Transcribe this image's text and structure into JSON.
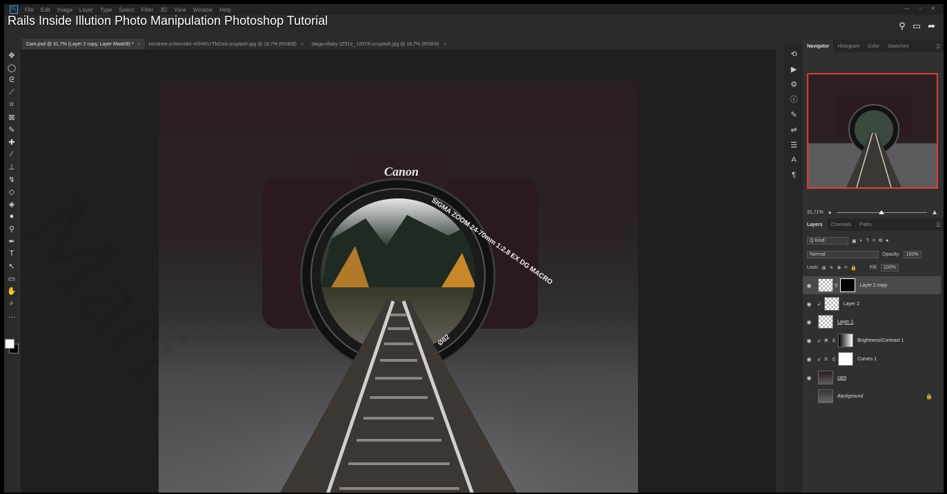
{
  "video_title": "Rails Inside Illution Photo Manipulation Photoshop Tutorial",
  "menu": [
    "File",
    "Edit",
    "Image",
    "Layer",
    "Type",
    "Select",
    "Filter",
    "3D",
    "View",
    "Window",
    "Help"
  ],
  "tabs": [
    {
      "label": "Cam.psd @ 31,7% (Layer 2 copy, Layer Mask/8) *",
      "close": "×"
    },
    {
      "label": "kendrew-schexnider-m5HKU-TbGaA-unsplash.jpg @ 16,7% (RGB/8)",
      "close": "×"
    },
    {
      "label": "daiga-ellaby-JZ51o_-UOY8-unsplash.jpg @ 16,7% (RGB/8)",
      "close": "×"
    }
  ],
  "tools": [
    "move-icon",
    "lasso-ellipse-icon",
    "lasso-icon",
    "quick-select-icon",
    "crop-icon",
    "frame-icon",
    "eyedropper-icon",
    "healing-icon",
    "brush-icon",
    "stamp-icon",
    "history-brush-icon",
    "eraser-icon",
    "paint-bucket-icon",
    "blur-icon",
    "dodge-icon",
    "pen-icon",
    "type-icon",
    "path-select-icon",
    "rectangle-icon",
    "hand-icon",
    "zoom-icon",
    "more-icon"
  ],
  "canvas": {
    "camera_brand": "Canon",
    "lens_text": "SIGMA ZOOM 24-70mm 1:2.8 EX DG MACRO",
    "lens_ring": "Ø82"
  },
  "panel": {
    "top_tabs": [
      "Navigator",
      "Histogram",
      "Color",
      "Swatches"
    ],
    "zoom": "31,71%",
    "layer_tabs": [
      "Layers",
      "Channels",
      "Paths"
    ],
    "filter_kind": "Q Kind",
    "blend_mode": "Normal",
    "opacity_label": "Opacity:",
    "opacity_value": "100%",
    "lock_label": "Lock:",
    "fill_label": "Fill:",
    "fill_value": "100%"
  },
  "layers": [
    {
      "name": "Layer 2 copy"
    },
    {
      "name": "Layer 2"
    },
    {
      "name": "Layer 1"
    },
    {
      "name": "Brightness/Contrast 1"
    },
    {
      "name": "Curves 1"
    },
    {
      "name": "cam"
    },
    {
      "name": "Background"
    }
  ],
  "accent_color": "#e03b3b",
  "watermark": "Mari"
}
